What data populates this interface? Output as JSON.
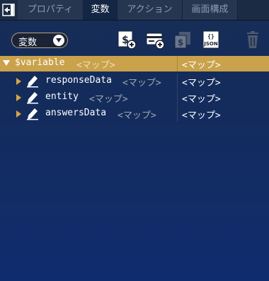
{
  "tabs": [
    {
      "label": "プロパティ",
      "active": false
    },
    {
      "label": "変数",
      "active": true
    },
    {
      "label": "アクション",
      "active": false
    },
    {
      "label": "画面構成",
      "active": false
    }
  ],
  "toolbar": {
    "scope_select": "変数",
    "json_icon_text": "JSON"
  },
  "rows": [
    {
      "name": "$variable",
      "type": "<マップ>",
      "value": "<マップ>",
      "selected": true,
      "expanded": true
    },
    {
      "name": "responseData",
      "type": "<マップ>",
      "value": "<マップ>",
      "selected": false,
      "expanded": false
    },
    {
      "name": "entity",
      "type": "<マップ>",
      "value": "<マップ>",
      "selected": false,
      "expanded": false
    },
    {
      "name": "answersData",
      "type": "<マップ>",
      "value": "<マップ>",
      "selected": false,
      "expanded": false
    }
  ],
  "colors": {
    "selected_row": "#c9a24b",
    "active_tab": "#132644",
    "tab": "#243650",
    "background": "#142c5c"
  }
}
